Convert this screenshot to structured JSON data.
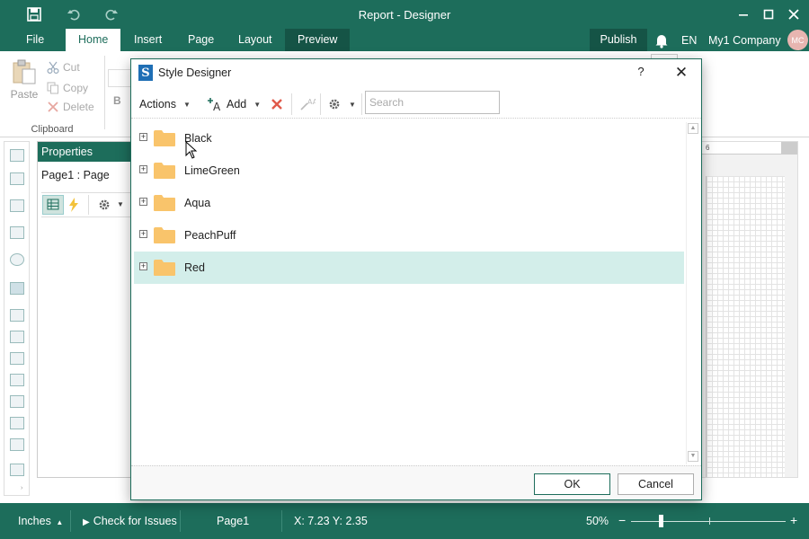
{
  "app": {
    "title": "Report - Designer",
    "window_controls": [
      "minimize",
      "maximize",
      "close"
    ]
  },
  "ribbon_tabs": [
    {
      "label": "File"
    },
    {
      "label": "Home"
    },
    {
      "label": "Insert"
    },
    {
      "label": "Page"
    },
    {
      "label": "Layout"
    },
    {
      "label": "Preview"
    }
  ],
  "ribbon_right": {
    "publish_label": "Publish",
    "language": "EN",
    "company": "My1 Company",
    "avatar_initials": "MC"
  },
  "clipboard": {
    "paste_label": "Paste",
    "cut_label": "Cut",
    "copy_label": "Copy",
    "delete_label": "Delete",
    "group_label": "Clipboard",
    "bold_glyph": "B"
  },
  "properties": {
    "title": "Properties",
    "selected": "Page1 : Page"
  },
  "ruler": {
    "tick": "6"
  },
  "dialog": {
    "title": "Style Designer",
    "logo_letter": "S",
    "help_label": "?",
    "toolbar": {
      "actions_label": "Actions",
      "add_label": "Add",
      "search_placeholder": "Search"
    },
    "styles": [
      {
        "label": "Black"
      },
      {
        "label": "LimeGreen"
      },
      {
        "label": "Aqua"
      },
      {
        "label": "PeachPuff"
      },
      {
        "label": "Red"
      }
    ],
    "selected_style": "Red",
    "ok_label": "OK",
    "cancel_label": "Cancel"
  },
  "status": {
    "units": "Inches",
    "check_issues": "Check for Issues",
    "page": "Page1",
    "coords": "X: 7.23 Y: 2.35",
    "zoom": "50%"
  },
  "colors": {
    "accent": "#1d6d5b",
    "selection": "#d3eeea",
    "folder": "#f9c46b",
    "delete_red": "#e05a4b"
  }
}
